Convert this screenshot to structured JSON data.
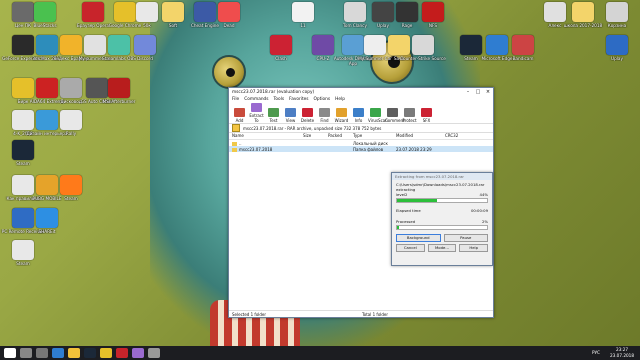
{
  "desktop_icons": [
    {
      "id": "i1",
      "label": "Цен ПК",
      "color": "#6a6a6a"
    },
    {
      "id": "i2",
      "label": "BlueStacks",
      "color": "#4ac14f"
    },
    {
      "id": "i3",
      "label": "Браузер Opera",
      "color": "#c8242b"
    },
    {
      "id": "i4",
      "label": "Google Chrome",
      "color": "#e5c02a"
    },
    {
      "id": "i5",
      "label": "50к",
      "color": "#e8e8e8"
    },
    {
      "id": "i6",
      "label": "Soft",
      "color": "#f3d46a"
    },
    {
      "id": "i7",
      "label": "Cheat Engine",
      "color": "#3c5aa6"
    },
    {
      "id": "i8",
      "label": "Dead",
      "color": "#ef4d4d"
    },
    {
      "id": "i9",
      "label": "11",
      "color": "#f2f2f2"
    },
    {
      "id": "i10",
      "label": "Tom Clancy",
      "color": "#d8d8d8"
    },
    {
      "id": "i11",
      "label": "Uplay",
      "color": "#444"
    },
    {
      "id": "i12",
      "label": "Rage",
      "color": "#333"
    },
    {
      "id": "i13",
      "label": "NFS",
      "color": "#c41c1c"
    },
    {
      "id": "i14",
      "label": "Алекс",
      "color": "#e0e0e0"
    },
    {
      "id": "i15",
      "label": "школа 2017-2018",
      "color": "#f3d46a"
    },
    {
      "id": "i16",
      "label": "Корзина",
      "color": "#d4d4d4"
    },
    {
      "id": "i17",
      "label": "GeForce Experience",
      "color": "#2a2a2a"
    },
    {
      "id": "i18",
      "label": "3ds Max 2017",
      "color": "#2d8dbb"
    },
    {
      "id": "i19",
      "label": "Яндекс Браузер",
      "color": "#f1b32a"
    },
    {
      "id": "i20",
      "label": "My summer car",
      "color": "#e1e1e1"
    },
    {
      "id": "i21",
      "label": "Streamlabs OBS",
      "color": "#4cc1a7"
    },
    {
      "id": "i22",
      "label": "Discord",
      "color": "#7289da"
    },
    {
      "id": "i23",
      "label": "Clash",
      "color": "#c23"
    },
    {
      "id": "i24",
      "label": "CPU-Z",
      "color": "#6f4aa6"
    },
    {
      "id": "i25",
      "label": "Autodesk Desktop App",
      "color": "#5a9fd4"
    },
    {
      "id": "i26",
      "label": "My Summer Car",
      "color": "#eeeeee"
    },
    {
      "id": "i27",
      "label": "Save",
      "color": "#f3d46a"
    },
    {
      "id": "i28",
      "label": "Counter-Strike Source",
      "color": "#d8d8d8"
    },
    {
      "id": "i29",
      "label": "Steam",
      "color": "#1b2838"
    },
    {
      "id": "i30",
      "label": "Microsoft Edge",
      "color": "#2f7dd1"
    },
    {
      "id": "i31",
      "label": "Bandicam",
      "color": "#c44"
    },
    {
      "id": "i32",
      "label": "Uplay",
      "color": "#2d6bc4"
    },
    {
      "id": "i33",
      "label": "Бирк",
      "color": "#e5c02a"
    },
    {
      "id": "i34",
      "label": "AIDA64 Extreme",
      "color": "#c22"
    },
    {
      "id": "i35",
      "label": "Дисковод",
      "color": "#aaa"
    },
    {
      "id": "i36",
      "label": "GS Auto Clicker",
      "color": "#555"
    },
    {
      "id": "i37",
      "label": "MSI Afterburner",
      "color": "#b81d1d"
    },
    {
      "id": "i38",
      "label": "4-K_2018",
      "color": "#e8e8e8"
    },
    {
      "id": "i39",
      "label": "Дизайн интерьера",
      "color": "#3a9ad9"
    },
    {
      "id": "i40",
      "label": "Rally",
      "color": "#e8e8e8"
    },
    {
      "id": "i41",
      "label": "Steam",
      "color": "#1b2838"
    },
    {
      "id": "i42",
      "label": "Как правильно",
      "color": "#e8e8e8"
    },
    {
      "id": "i43",
      "label": "PUBG MOBILE",
      "color": "#e5a32a"
    },
    {
      "id": "i44",
      "label": "Steam",
      "color": "#ff7a1a"
    },
    {
      "id": "i45",
      "label": "PC Remote Receiver",
      "color": "#2f6cc4"
    },
    {
      "id": "i46",
      "label": "SHAREit",
      "color": "#2d8fe3"
    },
    {
      "id": "i47",
      "label": "Steam",
      "color": "#e8e8e8"
    }
  ],
  "taskbar": {
    "items": [
      "start",
      "search",
      "task-view",
      "edge",
      "explorer",
      "steam",
      "chrome",
      "opera",
      "winrar",
      "settings"
    ],
    "lang": "РУС",
    "time": "23:27",
    "date": "23.07.2018"
  },
  "winrar": {
    "title": "mscc23.07.2018.rar (evaluation copy)",
    "menu": [
      "File",
      "Commands",
      "Tools",
      "Favorites",
      "Options",
      "Help"
    ],
    "tools": [
      {
        "label": "Add",
        "color": "#c94b3c"
      },
      {
        "label": "Extract To",
        "color": "#9a6ad0"
      },
      {
        "label": "Test",
        "color": "#4e9a4e"
      },
      {
        "label": "View",
        "color": "#4d7ec4"
      },
      {
        "label": "Delete",
        "color": "#c23"
      },
      {
        "label": "Find",
        "color": "#8a8a8a"
      },
      {
        "label": "Wizard",
        "color": "#e2a12c"
      },
      {
        "label": "Info",
        "color": "#3c7fc9"
      },
      {
        "label": "VirusScan",
        "color": "#3aa64a"
      },
      {
        "label": "Comment",
        "color": "#5e5e5e"
      },
      {
        "label": "Protect",
        "color": "#7a7a7a"
      },
      {
        "label": "SFX",
        "color": "#c23"
      }
    ],
    "path": "mscc23.07.2018.rar - RAR archive, unpacked size 732 378 752 bytes",
    "columns": [
      "Name",
      "Size",
      "Packed",
      "Type",
      "Modified",
      "CRC32"
    ],
    "rows": [
      {
        "name": "..",
        "size": "",
        "packed": "",
        "type": "Локальный диск",
        "modified": "",
        "crc": ""
      },
      {
        "name": "mscc23.07.2018",
        "size": "",
        "packed": "",
        "type": "Папка файлов",
        "modified": "23.07.2018 23:29",
        "crc": ""
      }
    ],
    "status_left": "Selected 1 folder",
    "status_right": "Total 1 folder"
  },
  "progress_dialog": {
    "title": "Extracting from mscc23.07.2018.rar",
    "archive_line": "C:\\Users\\sdmr\\Downloads\\mscc23.07.2018.rar",
    "action": "extracting",
    "file": "level2",
    "file_percent_label": "44%",
    "file_percent": 44,
    "elapsed_label": "Elapsed time",
    "elapsed_value": "00:00:09",
    "processed_label": "Processed",
    "processed_percent_label": "2%",
    "processed_percent": 2,
    "buttons": [
      "Background",
      "Pause",
      "Cancel",
      "Mode...",
      "Help"
    ]
  }
}
